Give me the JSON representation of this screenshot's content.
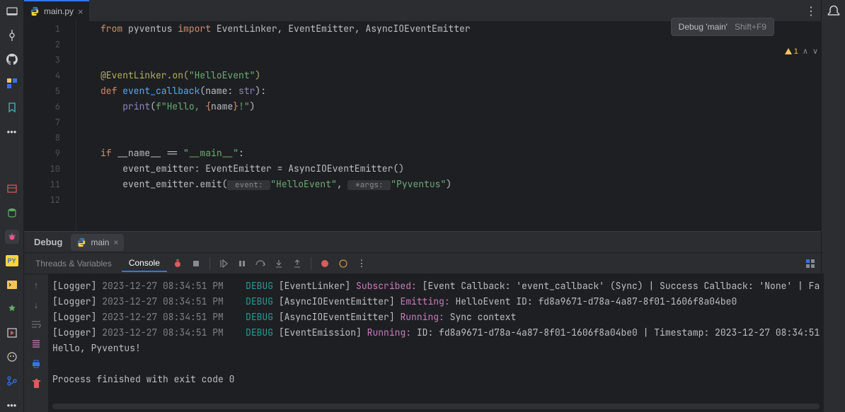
{
  "tab": {
    "filename": "main.py"
  },
  "tooltip": {
    "text": "Debug 'main'",
    "shortcut": "Shift+F9"
  },
  "status": {
    "warnings": "1"
  },
  "gutter_lines": [
    "1",
    "2",
    "3",
    "4",
    "5",
    "6",
    "7",
    "8",
    "9",
    "10",
    "11",
    "12"
  ],
  "code": {
    "l1": {
      "a": "from ",
      "b": "pyventus ",
      "c": "import ",
      "d": "EventLinker, EventEmitter, AsyncIOEventEmitter"
    },
    "l4": {
      "a": "@EventLinker.on(",
      "b": "\"HelloEvent\"",
      "c": ")"
    },
    "l5": {
      "a": "def ",
      "b": "event_callback",
      "c": "(name: ",
      "d": "str",
      "e": "):"
    },
    "l6": {
      "a": "    ",
      "b": "print",
      "c": "(",
      "d": "f\"Hello, ",
      "e": "{",
      "f": "name",
      "g": "}",
      "h": "!\"",
      "i": ")"
    },
    "l9": {
      "a": "if ",
      "b": "__name__ == ",
      "c": "\"__main__\"",
      "d": ":"
    },
    "l10": {
      "a": "    event_emitter: EventEmitter = AsyncIOEventEmitter()"
    },
    "l11": {
      "a": "    event_emitter.emit(",
      "h1": " event: ",
      "b": "\"HelloEvent\"",
      "c": ", ",
      "h2": " *args: ",
      "d": "\"Pyventus\"",
      "e": ")"
    }
  },
  "debug": {
    "title": "Debug",
    "tabname": "main",
    "subtabs": {
      "threads": "Threads & Variables",
      "console": "Console"
    }
  },
  "log": {
    "r1": {
      "lg": "[Logger] ",
      "ts": "2023-12-27 08:34:51 PM",
      "sp": "    ",
      "lvl": "DEBUG ",
      "brk": "[EventLinker] ",
      "act": "Subscribed: ",
      "msg": "[Event Callback: 'event_callback' (Sync) | Success Callback: 'None' | Fa"
    },
    "r2": {
      "lg": "[Logger] ",
      "ts": "2023-12-27 08:34:51 PM",
      "sp": "    ",
      "lvl": "DEBUG ",
      "brk": "[AsyncIOEventEmitter] ",
      "act": "Emitting: ",
      "msg": "HelloEvent ID: fd8a9671-d78a-4a87-8f01-1606f8a04be0"
    },
    "r3": {
      "lg": "[Logger] ",
      "ts": "2023-12-27 08:34:51 PM",
      "sp": "    ",
      "lvl": "DEBUG ",
      "brk": "[AsyncIOEventEmitter] ",
      "act": "Running: ",
      "msg": "Sync context"
    },
    "r4": {
      "lg": "[Logger] ",
      "ts": "2023-12-27 08:34:51 PM",
      "sp": "    ",
      "lvl": "DEBUG ",
      "brk": "[EventEmission] ",
      "act": "Running: ",
      "msg": "ID: fd8a9671-d78a-4a87-8f01-1606f8a04be0 | Timestamp: 2023-12-27 08:34:51"
    },
    "r5": "Hello, Pyventus!",
    "r6": "Process finished with exit code 0"
  }
}
